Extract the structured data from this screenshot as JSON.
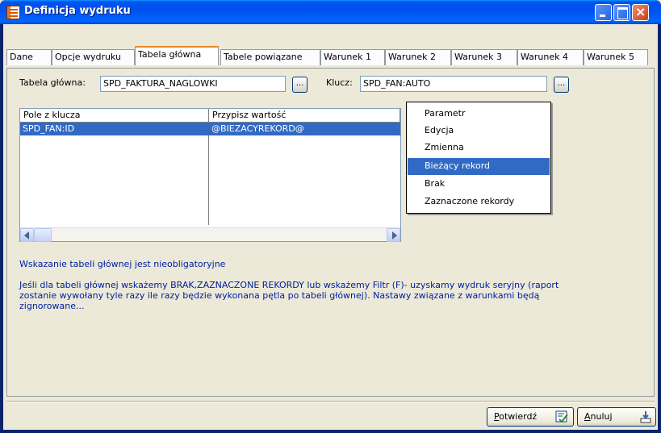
{
  "window": {
    "title": "Definicja wydruku"
  },
  "tabs": [
    {
      "label": "Dane",
      "active": false
    },
    {
      "label": "Opcje wydruku",
      "active": false
    },
    {
      "label": "Tabela główna",
      "active": true
    },
    {
      "label": "Tabele powiązane",
      "active": false
    },
    {
      "label": "Warunek 1",
      "active": false
    },
    {
      "label": "Warunek 2",
      "active": false
    },
    {
      "label": "Warunek 3",
      "active": false
    },
    {
      "label": "Warunek 4",
      "active": false
    },
    {
      "label": "Warunek 5",
      "active": false
    }
  ],
  "form": {
    "main_table_label": "Tabela główna:",
    "main_table_value": "SPD_FAKTURA_NAGLOWKI",
    "key_label": "Klucz:",
    "key_value": "SPD_FAN:AUTO",
    "browse_label": "..."
  },
  "grid": {
    "columns": [
      "Pole z klucza",
      "Przypisz wartość"
    ],
    "rows": [
      [
        "SPD_FAN:ID",
        "@BIEZACYREKORD@"
      ]
    ]
  },
  "dropdown": {
    "items": [
      "Parametr",
      "Edycja",
      "Zmienna",
      "Bieżący rekord",
      "Brak",
      "Zaznaczone rekordy"
    ],
    "selected": "Bieżący rekord"
  },
  "info": {
    "line1": "Wskazanie tabeli głównej jest nieobligatoryjne",
    "line2": "Jeśli dla tabeli głównej wskażemy BRAK,ZAZNACZONE REKORDY lub wskażemy Filtr (F)- uzyskamy wydruk seryjny (raport",
    "line3": "zostanie wywołany tyle razy ile razy będzie wykonana pętla po tabeli głównej). Nastawy związane z warunkami będą",
    "line4": "zignorowane..."
  },
  "buttons": {
    "confirm_first": "P",
    "confirm_rest": "otwierdź",
    "cancel_first": "A",
    "cancel_rest": "nuluj"
  },
  "colors": {
    "titlebar": "#0053ee",
    "selection": "#316ac5",
    "info_text": "#0020a0"
  }
}
